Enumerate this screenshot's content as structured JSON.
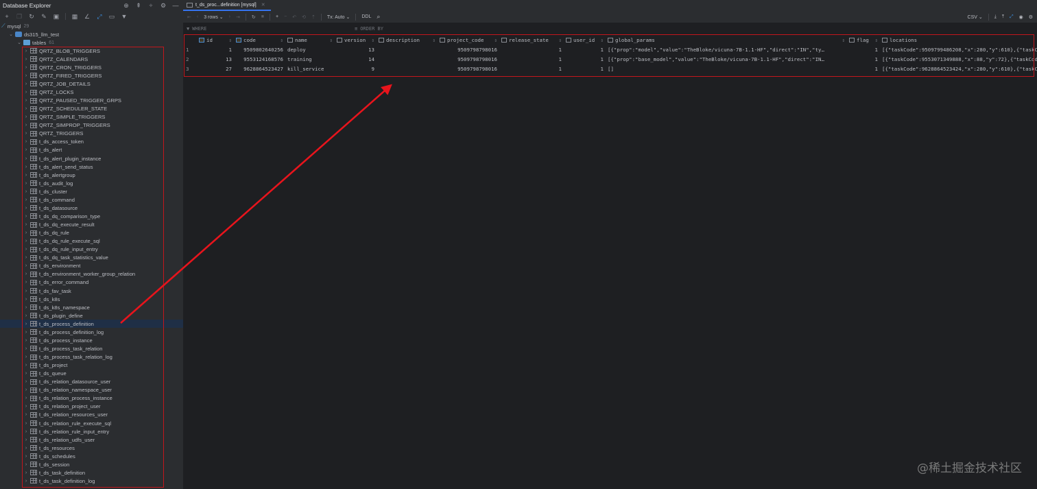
{
  "explorer": {
    "title": "Database Explorer",
    "header_icons": [
      "target-icon",
      "expand-all-icon",
      "collapse-all-icon",
      "gear-icon",
      "minimize-icon"
    ],
    "toolbar_icons": [
      "add-icon",
      "duplicate-icon",
      "refresh-icon",
      "properties-icon",
      "stop-icon",
      "table-icon",
      "edit-icon",
      "jump-icon",
      "console-icon",
      "filter-icon"
    ],
    "connection": {
      "label": "mysql",
      "count": "29"
    },
    "schema": {
      "label": "ds315_llm_test"
    },
    "tables_folder": {
      "label": "tables",
      "count": "61"
    },
    "tables": [
      "QRTZ_BLOB_TRIGGERS",
      "QRTZ_CALENDARS",
      "QRTZ_CRON_TRIGGERS",
      "QRTZ_FIRED_TRIGGERS",
      "QRTZ_JOB_DETAILS",
      "QRTZ_LOCKS",
      "QRTZ_PAUSED_TRIGGER_GRPS",
      "QRTZ_SCHEDULER_STATE",
      "QRTZ_SIMPLE_TRIGGERS",
      "QRTZ_SIMPROP_TRIGGERS",
      "QRTZ_TRIGGERS",
      "t_ds_access_token",
      "t_ds_alert",
      "t_ds_alert_plugin_instance",
      "t_ds_alert_send_status",
      "t_ds_alertgroup",
      "t_ds_audit_log",
      "t_ds_cluster",
      "t_ds_command",
      "t_ds_datasource",
      "t_ds_dq_comparison_type",
      "t_ds_dq_execute_result",
      "t_ds_dq_rule",
      "t_ds_dq_rule_execute_sql",
      "t_ds_dq_rule_input_entry",
      "t_ds_dq_task_statistics_value",
      "t_ds_environment",
      "t_ds_environment_worker_group_relation",
      "t_ds_error_command",
      "t_ds_fav_task",
      "t_ds_k8s",
      "t_ds_k8s_namespace",
      "t_ds_plugin_define",
      "t_ds_process_definition",
      "t_ds_process_definition_log",
      "t_ds_process_instance",
      "t_ds_process_task_relation",
      "t_ds_process_task_relation_log",
      "t_ds_project",
      "t_ds_queue",
      "t_ds_relation_datasource_user",
      "t_ds_relation_namespace_user",
      "t_ds_relation_process_instance",
      "t_ds_relation_project_user",
      "t_ds_relation_resources_user",
      "t_ds_relation_rule_execute_sql",
      "t_ds_relation_rule_input_entry",
      "t_ds_relation_udfs_user",
      "t_ds_resources",
      "t_ds_schedules",
      "t_ds_session",
      "t_ds_task_definition",
      "t_ds_task_definition_log"
    ],
    "selected_table": "t_ds_process_definition"
  },
  "editor": {
    "tab_label": "t_ds_proc...definition [mysql]",
    "toolbar": {
      "rows_label": "3 rows",
      "tx_label": "Tx: Auto",
      "ddl_label": "DDL",
      "export_format": "CSV"
    },
    "filter": {
      "where_placeholder": "WHERE",
      "order_by_placeholder": "ORDER BY"
    },
    "columns": [
      {
        "name": "id",
        "key": true
      },
      {
        "name": "code",
        "key": true
      },
      {
        "name": "name",
        "key": false
      },
      {
        "name": "version",
        "key": false
      },
      {
        "name": "description",
        "key": false
      },
      {
        "name": "project_code",
        "key": false
      },
      {
        "name": "release_state",
        "key": false
      },
      {
        "name": "user_id",
        "key": false
      },
      {
        "name": "global_params",
        "key": false
      },
      {
        "name": "flag",
        "key": false
      },
      {
        "name": "locations",
        "key": false
      }
    ],
    "rows": [
      {
        "rn": "1",
        "id": "1",
        "code": "9509802640256",
        "name": "deploy",
        "version": "13",
        "description": "",
        "project_code": "9509798798016",
        "release_state": "1",
        "user_id": "1",
        "global_params": "[{\"prop\":\"model\",\"value\":\"TheBloke/vicuna-7B-1.1-HF\",\"direct\":\"IN\",\"ty…",
        "flag": "1",
        "locations": "[{\"taskCode\":9509799486208,\"x\":280,\"y\":610},{\"taskCo"
      },
      {
        "rn": "2",
        "id": "13",
        "code": "9553124168576",
        "name": "training",
        "version": "14",
        "description": "",
        "project_code": "9509798798016",
        "release_state": "1",
        "user_id": "1",
        "global_params": "[{\"prop\":\"base_model\",\"value\":\"TheBloke/vicuna-7B-1.1-HF\",\"direct\":\"IN…",
        "flag": "1",
        "locations": "[{\"taskCode\":9553071349888,\"x\":88,\"y\":72},{\"taskCod"
      },
      {
        "rn": "3",
        "id": "27",
        "code": "9628864523427",
        "name": "kill_service",
        "version": "9",
        "description": "",
        "project_code": "9509798798016",
        "release_state": "1",
        "user_id": "1",
        "global_params": "[]",
        "flag": "1",
        "locations": "[{\"taskCode\":9628864523424,\"x\":280,\"y\":610},{\"taskCo"
      }
    ]
  },
  "annotation": {
    "color": "#e8141c"
  },
  "watermark": "@稀土掘金技术社区"
}
